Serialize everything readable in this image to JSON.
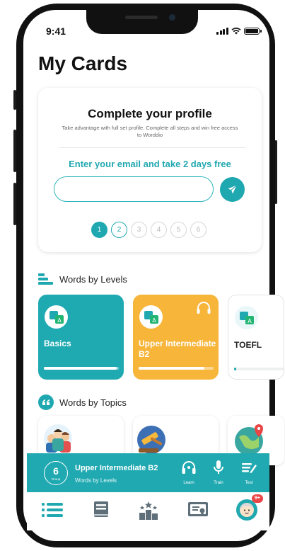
{
  "status_bar": {
    "time": "9:41"
  },
  "page": {
    "title": "My Cards"
  },
  "profile_card": {
    "title": "Complete your profile",
    "description": "Take advantage with full set profile. Complete all steps and win free access to Worddio",
    "cta": "Enter your email and take 2 days free",
    "email_placeholder": "",
    "email_value": "",
    "steps": [
      "1",
      "2",
      "3",
      "4",
      "5",
      "6"
    ],
    "completed_steps": 1,
    "current_step": 2
  },
  "levels_section": {
    "heading": "Words by Levels",
    "cards": [
      {
        "label": "Basics",
        "progress": 0.97,
        "color": "#1faab2"
      },
      {
        "label": "Upper Intermediate B2",
        "progress": 0.88,
        "color": "#f7b53a"
      },
      {
        "label": "TOEFL",
        "progress": 0.03,
        "color": "#ffffff"
      }
    ]
  },
  "topics_section": {
    "heading": "Words by Topics"
  },
  "player": {
    "group_number": "6",
    "group_label": "Group",
    "title": "Upper Intermediate B2",
    "subtitle": "Words by Levels",
    "actions": [
      "Learn",
      "Train",
      "Test"
    ]
  },
  "tabbar": {
    "notification_badge": "9+"
  },
  "colors": {
    "accent": "#1fa8b0",
    "orange": "#f7b53a",
    "badge": "#e94545"
  }
}
